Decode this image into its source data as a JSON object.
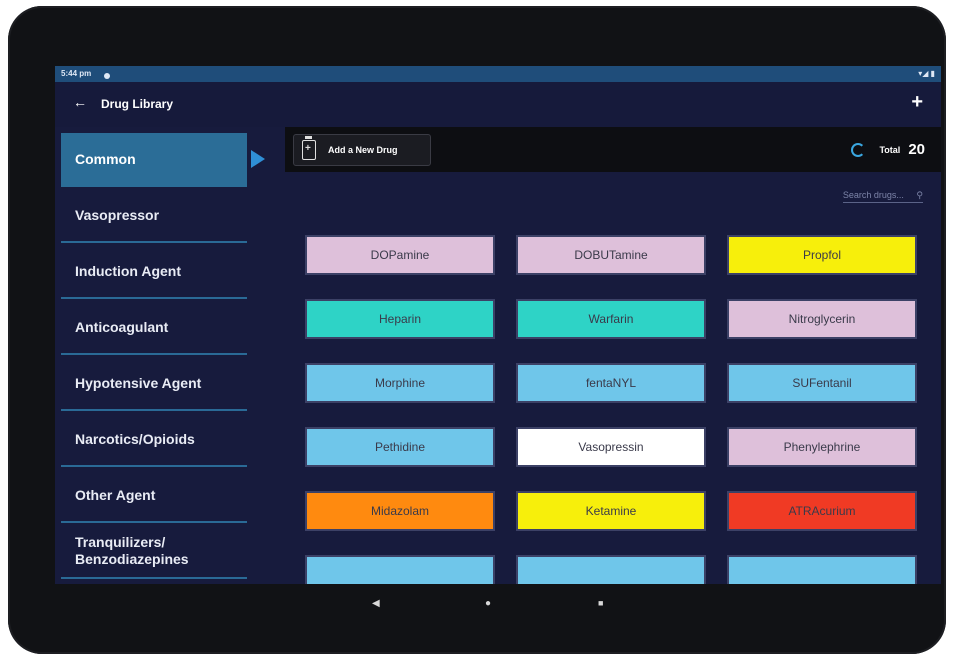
{
  "status_bar": {
    "time": "5:44 pm",
    "right": "▾◢ ▮"
  },
  "app_bar": {
    "back_icon": "arrow-left-icon",
    "title": "Drug Library",
    "add_icon": "plus-icon"
  },
  "sidebar": {
    "categories": [
      {
        "label": "Common",
        "active": true
      },
      {
        "label": "Vasopressor"
      },
      {
        "label": "Induction Agent"
      },
      {
        "label": "Anticoagulant"
      },
      {
        "label": "Hypotensive Agent"
      },
      {
        "label": "Narcotics/Opioids"
      },
      {
        "label": "Other Agent"
      },
      {
        "label": "Tranquilizers/\nBenzodiazepines"
      }
    ]
  },
  "toolbar": {
    "add_drug_label": "Add a New Drug",
    "total_label": "Total",
    "total_count": "20"
  },
  "search": {
    "placeholder": "Search drugs...",
    "icon": "search-icon"
  },
  "colors": {
    "lavender": "#dec0da",
    "teal": "#2ed3c6",
    "blue": "#6fc6ea",
    "yellow": "#f7ef0b",
    "white": "#ffffff",
    "orange": "#ff8a0f",
    "red": "#f03a24"
  },
  "drugs": [
    {
      "name": "DOPamine",
      "color": "#dec0da"
    },
    {
      "name": "DOBUTamine",
      "color": "#dec0da"
    },
    {
      "name": "Propfol",
      "color": "#f7ef0b"
    },
    {
      "name": "Heparin",
      "color": "#2ed3c6"
    },
    {
      "name": "Warfarin",
      "color": "#2ed3c6"
    },
    {
      "name": "Nitroglycerin",
      "color": "#dec0da"
    },
    {
      "name": "Morphine",
      "color": "#6fc6ea"
    },
    {
      "name": "fentaNYL",
      "color": "#6fc6ea"
    },
    {
      "name": "SUFentanil",
      "color": "#6fc6ea"
    },
    {
      "name": "Pethidine",
      "color": "#6fc6ea"
    },
    {
      "name": "Vasopressin",
      "color": "#ffffff"
    },
    {
      "name": "Phenylephrine",
      "color": "#dec0da"
    },
    {
      "name": "Midazolam",
      "color": "#ff8a0f"
    },
    {
      "name": "Ketamine",
      "color": "#f7ef0b"
    },
    {
      "name": "ATRAcurium",
      "color": "#f03a24"
    },
    {
      "name": "",
      "color": "#6fc6ea"
    },
    {
      "name": "",
      "color": "#6fc6ea"
    },
    {
      "name": "",
      "color": "#6fc6ea"
    }
  ],
  "nav_bar": {
    "back": "◀",
    "home": "●",
    "recents": "■"
  }
}
